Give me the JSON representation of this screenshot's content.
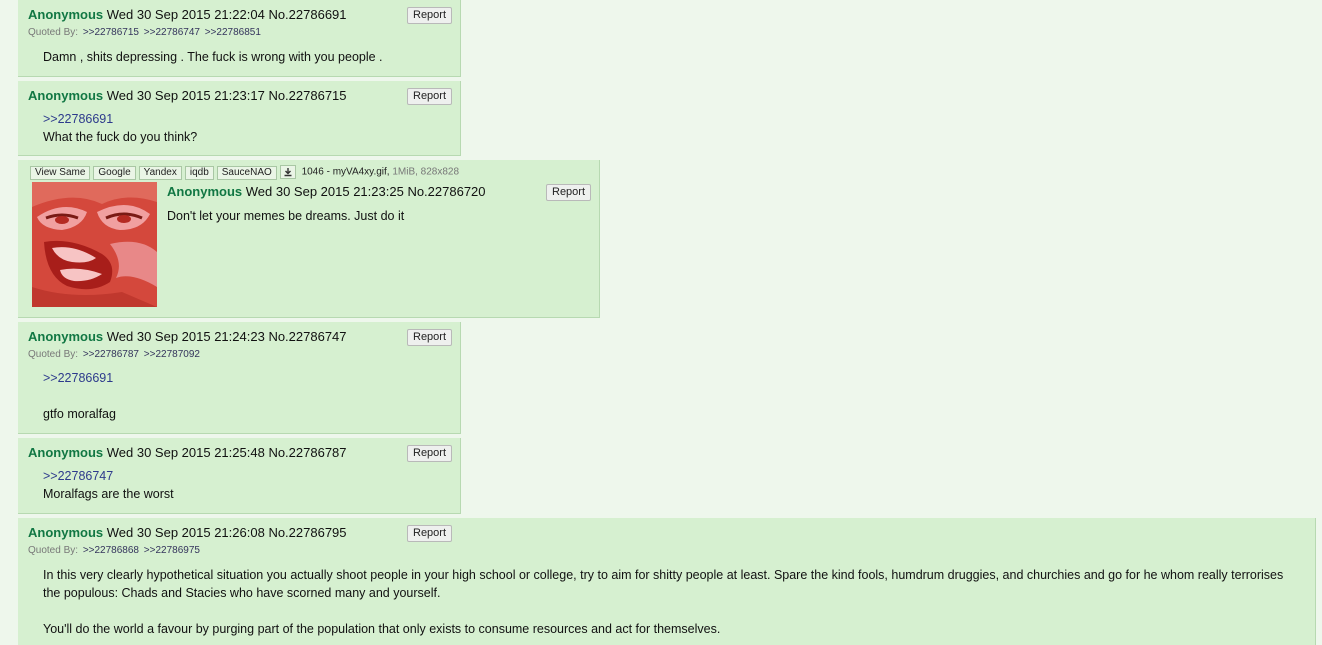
{
  "report_label": "Report",
  "quoted_by_label": "Quoted By:",
  "posts": [
    {
      "name": "Anonymous",
      "date": "Wed 30 Sep 2015 21:22:04",
      "no": "No.22786691",
      "quoted_by": [
        ">>22786715",
        ">>22786747",
        ">>22786851"
      ],
      "lines": [
        "Damn , shits depressing . The fuck is wrong with you people ."
      ]
    },
    {
      "name": "Anonymous",
      "date": "Wed 30 Sep 2015 21:23:17",
      "no": "No.22786715",
      "quote": ">>22786691",
      "lines": [
        "What the fuck do you think?"
      ]
    },
    {
      "name": "Anonymous",
      "date": "Wed 30 Sep 2015 21:23:25",
      "no": "No.22786720",
      "image_tools": [
        "View Same",
        "Google",
        "Yandex",
        "iqdb",
        "SauceNAO"
      ],
      "file_name": "1046 - myVA4xy.gif,",
      "file_info": "1MiB, 828x828",
      "lines": [
        "Don't let your memes be dreams. Just do it"
      ]
    },
    {
      "name": "Anonymous",
      "date": "Wed 30 Sep 2015 21:24:23",
      "no": "No.22786747",
      "quoted_by": [
        ">>22786787",
        ">>22787092"
      ],
      "quote": ">>22786691",
      "lines": [
        "gtfo moralfag"
      ]
    },
    {
      "name": "Anonymous",
      "date": "Wed 30 Sep 2015 21:25:48",
      "no": "No.22786787",
      "quote": ">>22786747",
      "lines": [
        "Moralfags are the worst"
      ]
    },
    {
      "name": "Anonymous",
      "date": "Wed 30 Sep 2015 21:26:08",
      "no": "No.22786795",
      "quoted_by": [
        ">>22786868",
        ">>22786975"
      ],
      "lines": [
        "In this very clearly hypothetical situation you actually shoot people in your high school or college, try to aim for shitty people at least. Spare the kind fools, humdrum druggies, and churchies and go for he whom really terrorises the populous: Chads and Stacies who have scorned many and yourself.",
        "You'll do the world a favour by purging part of the population that only exists to consume resources and act for themselves."
      ]
    }
  ]
}
